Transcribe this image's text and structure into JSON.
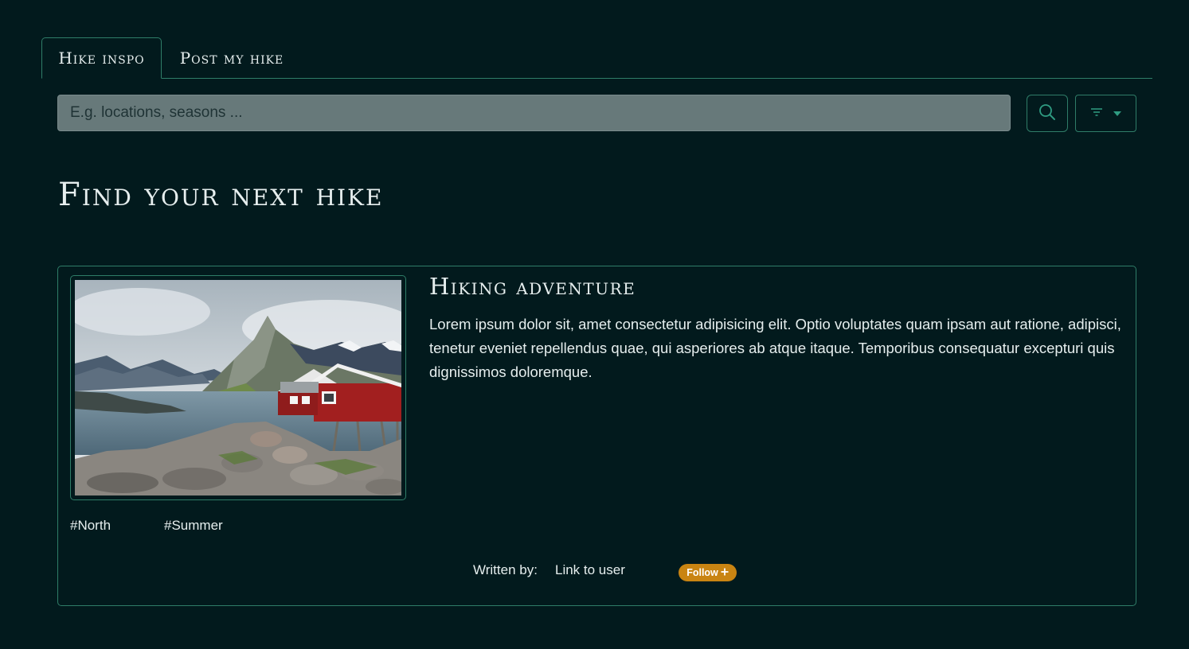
{
  "tabs": [
    {
      "label": "Hike inspo",
      "active": true
    },
    {
      "label": "Post my hike",
      "active": false
    }
  ],
  "search": {
    "placeholder": "E.g. locations, seasons ...",
    "value": "",
    "search_icon": "search-icon",
    "filter_icon": "filter-icon",
    "dropdown_icon": "caret-down-icon"
  },
  "page": {
    "title": "Find your next hike"
  },
  "card": {
    "title": "Hiking adventure",
    "body": "Lorem ipsum dolor sit, amet consectetur adipisicing elit. Optio voluptates quam ipsam aut ratione, adipisci, tenetur eveniet repellendus quae, qui asperiores ab atque itaque. Temporibus consequatur excepturi quis dignissimos doloremque.",
    "tags": [
      "#North",
      "#Summer"
    ],
    "written_by_label": "Written by:",
    "user_link": "Link to user",
    "follow_label": "Follow",
    "follow_icon": "plus-icon"
  },
  "colors": {
    "background": "#021a1d",
    "accent_border": "#2f7d68",
    "follow_button": "#c98412",
    "search_field": "#67797a"
  }
}
